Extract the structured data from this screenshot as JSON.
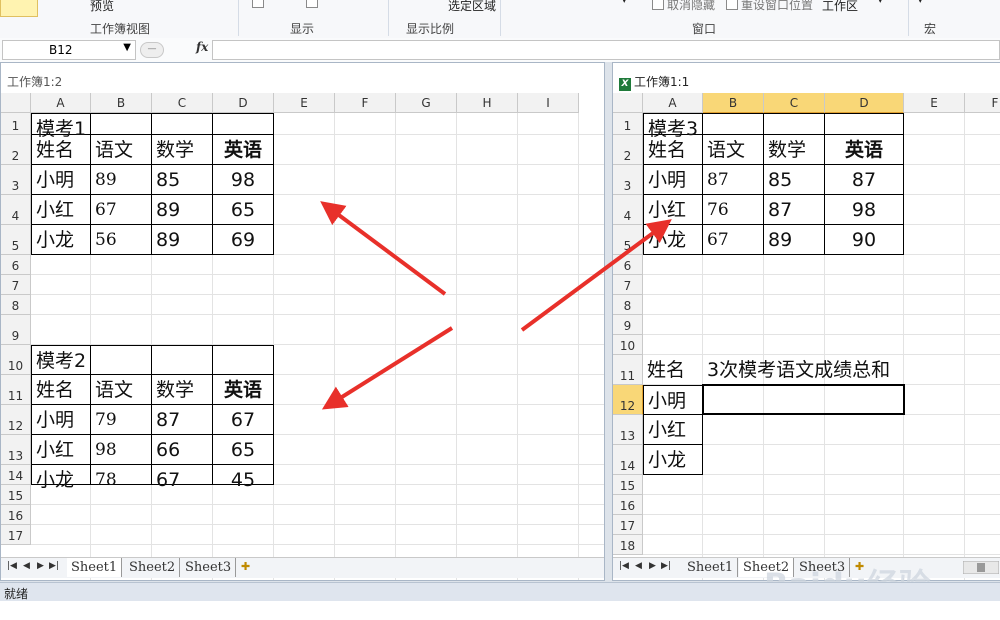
{
  "ribbon": {
    "preview_label": "预览",
    "workbook_views_label": "工作簿视图",
    "show_label": "显示",
    "zoom_label": "显示比例",
    "zoom_to_selection_label": "选定区域",
    "unhide_label": "取消隐藏",
    "reset_window_label": "重设窗口位置",
    "workspace_label": "工作区",
    "window_label": "窗口",
    "macro_label": "宏"
  },
  "formula_bar": {
    "name_box": "B12",
    "fx_label": "fx",
    "value": ""
  },
  "windows": [
    {
      "title": "工作簿1:2",
      "columns": [
        "A",
        "B",
        "C",
        "D",
        "E",
        "F",
        "G",
        "H",
        "I"
      ],
      "rows": [
        "1",
        "2",
        "3",
        "4",
        "5",
        "6",
        "7",
        "8",
        "9",
        "10",
        "11",
        "12",
        "13",
        "14",
        "15",
        "16",
        "17"
      ],
      "tabs": [
        "Sheet1",
        "Sheet2",
        "Sheet3"
      ],
      "tables": [
        {
          "title": "模考1",
          "headers": [
            "姓名",
            "语文",
            "数学",
            "英语"
          ],
          "rows": [
            [
              "小明",
              "89",
              "85",
              "98"
            ],
            [
              "小红",
              "67",
              "89",
              "65"
            ],
            [
              "小龙",
              "56",
              "89",
              "69"
            ]
          ]
        },
        {
          "title": "模考2",
          "headers": [
            "姓名",
            "语文",
            "数学",
            "英语"
          ],
          "rows": [
            [
              "小明",
              "79",
              "87",
              "67"
            ],
            [
              "小红",
              "98",
              "66",
              "65"
            ],
            [
              "小龙",
              "78",
              "67",
              "45"
            ]
          ]
        }
      ]
    },
    {
      "title": "工作簿1:1",
      "columns": [
        "A",
        "B",
        "C",
        "D",
        "E",
        "F"
      ],
      "rows": [
        "1",
        "2",
        "3",
        "4",
        "5",
        "6",
        "7",
        "8",
        "9",
        "10",
        "11",
        "12",
        "13",
        "14",
        "15",
        "16",
        "17",
        "18"
      ],
      "tabs": [
        "Sheet1",
        "Sheet2",
        "Sheet3"
      ],
      "tables": [
        {
          "title": "模考3",
          "headers": [
            "姓名",
            "语文",
            "数学",
            "英语"
          ],
          "rows": [
            [
              "小明",
              "87",
              "85",
              "87"
            ],
            [
              "小红",
              "76",
              "87",
              "98"
            ],
            [
              "小龙",
              "67",
              "89",
              "90"
            ]
          ]
        }
      ],
      "summary": {
        "name_header": "姓名",
        "total_header": "3次模考语文成绩总和",
        "names": [
          "小明",
          "小红",
          "小龙"
        ]
      }
    }
  ],
  "status_bar": {
    "text": "就绪"
  },
  "watermark": {
    "text": "Baidu经验"
  },
  "colors": {
    "arrow": "#e8302a",
    "header_highlight": "#f9d777"
  }
}
